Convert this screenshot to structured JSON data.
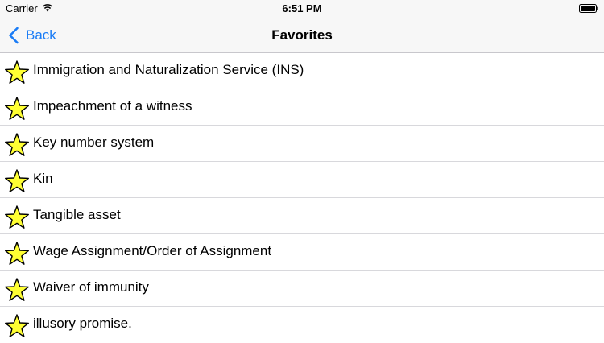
{
  "status_bar": {
    "carrier": "Carrier",
    "time": "6:51 PM",
    "wifi_icon": "wifi-icon",
    "battery_icon": "battery-icon"
  },
  "nav_bar": {
    "back_label": "Back",
    "back_icon": "chevron-left-icon",
    "title": "Favorites"
  },
  "favorites": {
    "icon": "star-icon",
    "star_color": "#ffff33",
    "items": [
      {
        "label": "Immigration and Naturalization Service (INS)"
      },
      {
        "label": "Impeachment of a witness"
      },
      {
        "label": "Key number system"
      },
      {
        "label": "Kin"
      },
      {
        "label": "Tangible asset"
      },
      {
        "label": "Wage Assignment/Order of Assignment"
      },
      {
        "label": "Waiver of immunity"
      },
      {
        "label": "illusory promise."
      }
    ]
  },
  "colors": {
    "accent": "#1a7cf6",
    "bar_background": "#f7f7f7",
    "separator": "#d8d8dc"
  }
}
